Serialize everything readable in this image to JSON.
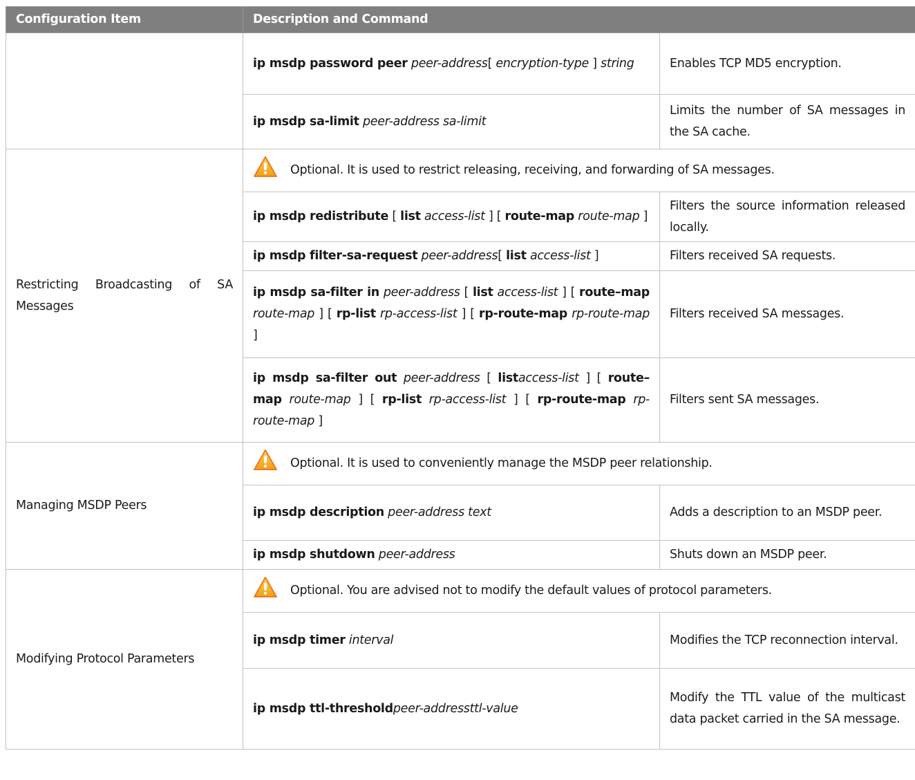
{
  "headers": {
    "item": "Configuration Item",
    "desc": "Description and Command"
  },
  "rows": {
    "password": {
      "cmd": [
        {
          "t": "ip msdp password peer",
          "s": "k"
        },
        {
          "t": " ",
          "s": ""
        },
        {
          "t": "peer-address",
          "s": "a"
        },
        {
          "t": "[ ",
          "s": ""
        },
        {
          "t": "encryption-type",
          "s": "a"
        },
        {
          "t": " ] ",
          "s": ""
        },
        {
          "t": "string",
          "s": "a"
        }
      ],
      "desc": "Enables TCP MD5 encryption."
    },
    "sa_limit": {
      "cmd": [
        {
          "t": "ip msdp sa-limit",
          "s": "k"
        },
        {
          "t": " ",
          "s": ""
        },
        {
          "t": "peer-address sa-limit",
          "s": "a"
        }
      ],
      "desc": "Limits the number of SA messages in the SA cache."
    }
  },
  "groups": {
    "restrict": {
      "item": "Restricting Broadcasting of SA Messages",
      "note": "Optional. It is used to restrict releasing, receiving, and forwarding of SA messages.",
      "r1": {
        "cmd": [
          {
            "t": "ip msdp redistribute",
            "s": "k"
          },
          {
            "t": " [ ",
            "s": ""
          },
          {
            "t": "list",
            "s": "k"
          },
          {
            "t": " ",
            "s": ""
          },
          {
            "t": "access-list",
            "s": "a"
          },
          {
            "t": " ] [ ",
            "s": ""
          },
          {
            "t": "route-map",
            "s": "k"
          },
          {
            "t": " ",
            "s": ""
          },
          {
            "t": "route-map",
            "s": "a"
          },
          {
            "t": " ]",
            "s": ""
          }
        ],
        "desc": "Filters the source information released locally."
      },
      "r2": {
        "cmd": [
          {
            "t": "ip msdp filter-sa-request",
            "s": "k"
          },
          {
            "t": " ",
            "s": ""
          },
          {
            "t": "peer-address",
            "s": "a"
          },
          {
            "t": "[ ",
            "s": ""
          },
          {
            "t": "list",
            "s": "k"
          },
          {
            "t": " ",
            "s": ""
          },
          {
            "t": "access-list",
            "s": "a"
          },
          {
            "t": " ]",
            "s": ""
          }
        ],
        "desc": "Filters received SA requests."
      },
      "r3": {
        "cmd": [
          {
            "t": "ip msdp sa-filter in",
            "s": "k"
          },
          {
            "t": " ",
            "s": ""
          },
          {
            "t": "peer-address",
            "s": "a"
          },
          {
            "t": " [ ",
            "s": ""
          },
          {
            "t": "list",
            "s": "k"
          },
          {
            "t": " ",
            "s": ""
          },
          {
            "t": "access-list",
            "s": "a"
          },
          {
            "t": " ] [ ",
            "s": ""
          },
          {
            "t": "route–map",
            "s": "k"
          },
          {
            "t": " ",
            "s": ""
          },
          {
            "t": "route-map",
            "s": "a"
          },
          {
            "t": " ] [ ",
            "s": ""
          },
          {
            "t": "rp-list",
            "s": "k"
          },
          {
            "t": " ",
            "s": ""
          },
          {
            "t": "rp-access-list",
            "s": "a"
          },
          {
            "t": " ] [ ",
            "s": ""
          },
          {
            "t": "rp-route-map",
            "s": "k"
          },
          {
            "t": " ",
            "s": ""
          },
          {
            "t": "rp-route-map",
            "s": "a"
          },
          {
            "t": " ]",
            "s": ""
          }
        ],
        "desc": "Filters received SA messages."
      },
      "r4": {
        "cmd": [
          {
            "t": "ip msdp sa-filter out",
            "s": "k"
          },
          {
            "t": " ",
            "s": ""
          },
          {
            "t": "peer-address",
            "s": "a"
          },
          {
            "t": " [ ",
            "s": ""
          },
          {
            "t": "list",
            "s": "k"
          },
          {
            "t": "access-list",
            "s": "a"
          },
          {
            "t": " ] [ ",
            "s": ""
          },
          {
            "t": "route–map",
            "s": "k"
          },
          {
            "t": " ",
            "s": ""
          },
          {
            "t": "route-map",
            "s": "a"
          },
          {
            "t": " ] [ ",
            "s": ""
          },
          {
            "t": "rp-list",
            "s": "k"
          },
          {
            "t": " ",
            "s": ""
          },
          {
            "t": "rp-access-list",
            "s": "a"
          },
          {
            "t": " ] [ ",
            "s": ""
          },
          {
            "t": "rp-route-map",
            "s": "k"
          },
          {
            "t": " ",
            "s": ""
          },
          {
            "t": "rp-route-map",
            "s": "a"
          },
          {
            "t": " ]",
            "s": ""
          }
        ],
        "desc": "Filters sent SA messages."
      }
    },
    "peers": {
      "item": "Managing MSDP Peers",
      "note": "Optional. It is used to conveniently manage the MSDP peer relationship.",
      "r1": {
        "cmd": [
          {
            "t": "ip msdp description",
            "s": "k"
          },
          {
            "t": " ",
            "s": ""
          },
          {
            "t": "peer-address text",
            "s": "a"
          }
        ],
        "desc": "Adds a description to an MSDP peer."
      },
      "r2": {
        "cmd": [
          {
            "t": "ip msdp shutdown",
            "s": "k"
          },
          {
            "t": " ",
            "s": ""
          },
          {
            "t": "peer-address",
            "s": "a"
          }
        ],
        "desc": "Shuts down an MSDP peer."
      }
    },
    "params": {
      "item": "Modifying Protocol Parameters",
      "note": "Optional. You are advised not to modify the default values of protocol parameters.",
      "r1": {
        "cmd": [
          {
            "t": "ip msdp timer",
            "s": "k"
          },
          {
            "t": " ",
            "s": ""
          },
          {
            "t": "interval",
            "s": "a"
          }
        ],
        "desc": "Modifies the TCP reconnection interval."
      },
      "r2": {
        "cmd": [
          {
            "t": "ip msdp ttl-threshold",
            "s": "k"
          },
          {
            "t": "peer-addressttl-value",
            "s": "a"
          }
        ],
        "desc": "Modify the TTL value of the multicast data packet carried in the SA message."
      }
    }
  },
  "icons": {
    "warning": {
      "name": "warning-icon",
      "fill": "#f39c12",
      "edge": "#e67e22",
      "mark": "#ffffff"
    }
  },
  "colors": {
    "header_bg": "#7f7f7f",
    "header_text": "#ffffff",
    "border": "#c2c2c2"
  }
}
